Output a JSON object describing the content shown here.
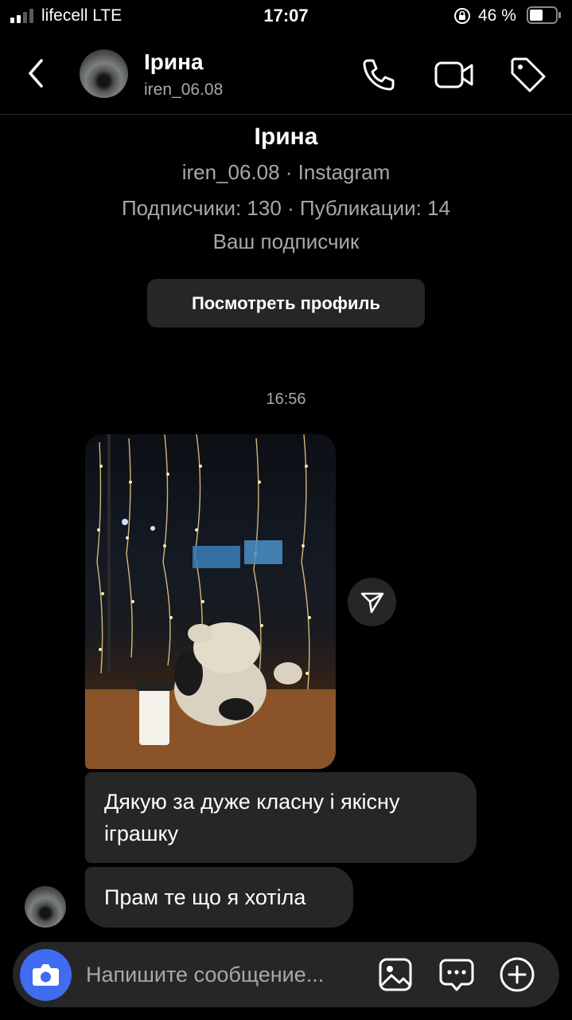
{
  "status_bar": {
    "carrier": "lifecell  LTE",
    "time": "17:07",
    "battery": "46 %"
  },
  "header": {
    "name": "Ірина",
    "username": "iren_06.08"
  },
  "profile": {
    "name": "Ірина",
    "source": "iren_06.08 · Instagram",
    "stats": "Подписчики: 130 · Публикации: 14",
    "relation": "Ваш подписчик",
    "view_profile_label": "Посмотреть профиль"
  },
  "chat": {
    "timestamp": "16:56",
    "messages": [
      {
        "text": "Дякую за дуже класну і якісну іграшку"
      },
      {
        "text": "Прам те що я хотіла"
      }
    ]
  },
  "composer": {
    "placeholder": "Напишите сообщение..."
  },
  "colors": {
    "background": "#000000",
    "bubble": "#262626",
    "accent": "#3f6cf0",
    "secondary_text": "#a8a8a8"
  },
  "icons": [
    "signal-icon",
    "lock-rotation-icon",
    "battery-icon",
    "back-icon",
    "phone-icon",
    "video-icon",
    "tag-icon",
    "send-icon",
    "camera-icon",
    "gallery-icon",
    "sticker-icon",
    "plus-icon"
  ]
}
